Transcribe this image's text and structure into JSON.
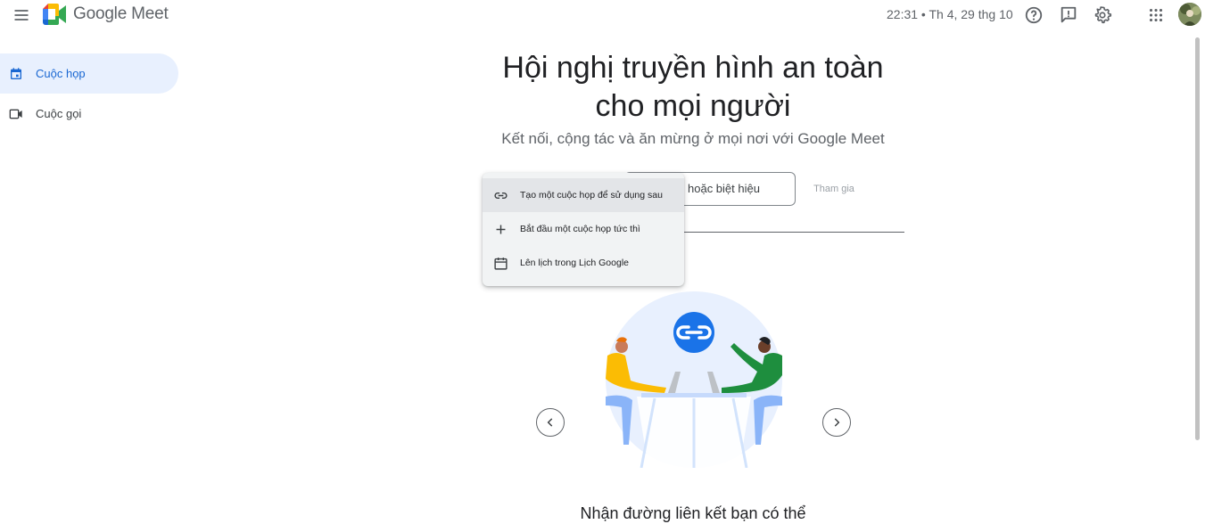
{
  "header": {
    "app_name": "Google Meet",
    "datetime": "22:31 • Th 4, 29 thg 10",
    "icons": [
      "menu-icon",
      "help-icon",
      "feedback-icon",
      "settings-icon",
      "apps-grid-icon"
    ]
  },
  "sidebar": {
    "items": [
      {
        "label": "Cuộc họp",
        "icon": "calendar-icon",
        "active": true
      },
      {
        "label": "Cuộc gọi",
        "icon": "video-camera-icon",
        "active": false
      }
    ]
  },
  "main": {
    "headline_line1": "Hội nghị truyền hình an toàn",
    "headline_line2": "cho mọi người",
    "subheadline": "Kết nối, cộng tác và ăn mừng ở mọi nơi với Google Meet",
    "code_input_value": "hoặc biệt hiệu",
    "join_label": "Tham gia",
    "caption": "Nhận đường liên kết bạn có thể"
  },
  "new_meeting_menu": {
    "items": [
      {
        "label": "Tạo một cuộc họp để sử dụng sau",
        "icon": "link-icon"
      },
      {
        "label": "Bắt đầu một cuộc họp tức thì",
        "icon": "plus-icon"
      },
      {
        "label": "Lên lịch trong Lịch Google",
        "icon": "calendar-icon"
      }
    ]
  },
  "colors": {
    "accent": "#1a73e8",
    "active_nav_bg": "#e8f0fe",
    "menu_bg": "#f1f3f4"
  }
}
